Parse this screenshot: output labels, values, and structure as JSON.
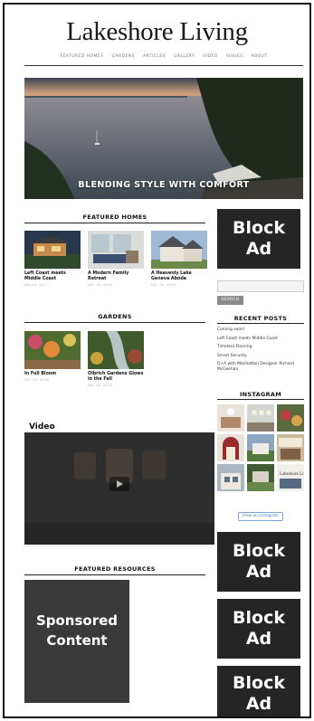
{
  "site": {
    "logo": "Lakeshore Living"
  },
  "nav": [
    "FEATURED HOMES",
    "GARDENS",
    "ARTICLES",
    "GALLERY",
    "VIDEO",
    "ISSUES",
    "ABOUT"
  ],
  "hero": {
    "caption": "BLENDING STYLE WITH COMFORT"
  },
  "featured_homes": {
    "title": "FEATURED HOMES",
    "items": [
      {
        "title": "Left Coast meets Middle Coast",
        "date": "JUN 09, 2017"
      },
      {
        "title": "A Modern Family Retreat",
        "date": "DEC 05, 2016"
      },
      {
        "title": "A Heavenly Lake Geneva Abode",
        "date": "DEC 05, 2016"
      }
    ]
  },
  "gardens": {
    "title": "GARDENS",
    "items": [
      {
        "title": "In Full Bloom",
        "date": "DEC 05, 2016"
      },
      {
        "title": "Olbrich Gardens Glows in the Fall",
        "date": "DEC 05, 2016"
      }
    ]
  },
  "video": {
    "label": "Video"
  },
  "featured_resources": {
    "title": "FEATURED RESOURCES"
  },
  "sponsored": {
    "label_line1": "Sponsored",
    "label_line2": "Content"
  },
  "ads": {
    "line1": "Block",
    "line2": "Ad"
  },
  "sidebar": {
    "search_button": "SEARCH",
    "recent_posts_title": "RECENT POSTS",
    "recent_posts": [
      "Coming soon!",
      "Left Coast meets Middle Coast",
      "Timeless Flooring",
      "Smart Security",
      "Q+A with Manhattan Designer Richard McGeehan"
    ],
    "instagram_title": "INSTAGRAM",
    "instagram_button": "View on Instagram"
  },
  "colors": {
    "ad_background": "#252525",
    "sponsored_background": "#3a3a3a",
    "instagram_button": "#4a7fbf"
  }
}
